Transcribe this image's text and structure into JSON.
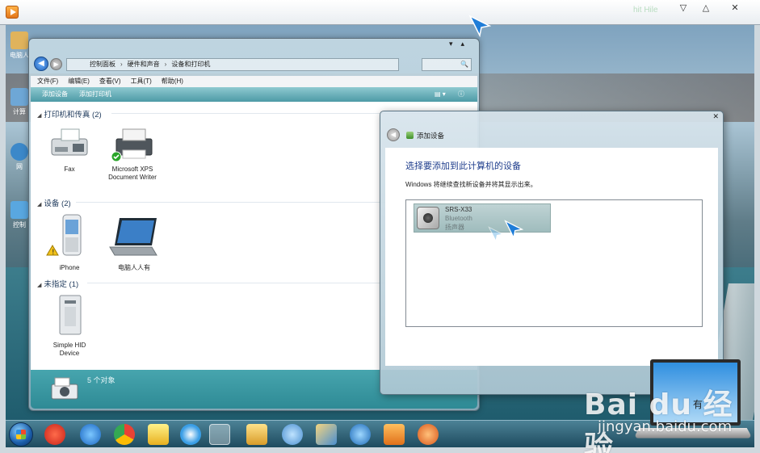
{
  "player": {
    "controls": [
      "▽",
      "△",
      "✕"
    ],
    "watermark_text": "hit Hile"
  },
  "desktop": {
    "icons": [
      {
        "label": "电脑人",
        "color": "#e0b35c"
      },
      {
        "label": "计算",
        "color": "#6ea7d6"
      },
      {
        "label": "网",
        "color": "#3c88c9"
      },
      {
        "label": "控制",
        "color": "#59a7e0"
      }
    ]
  },
  "explorer": {
    "breadcrumb": [
      "控制面板",
      "硬件和声音",
      "设备和打印机"
    ],
    "search_placeholder": "🔍",
    "menu": [
      "文件(F)",
      "编辑(E)",
      "查看(V)",
      "工具(T)",
      "帮助(H)"
    ],
    "commands": [
      "添加设备",
      "添加打印机"
    ],
    "groups": {
      "printers": {
        "title": "打印机和传真",
        "count": "(2)"
      },
      "devices": {
        "title": "设备",
        "count": "(2)"
      },
      "unspecified": {
        "title": "未指定",
        "count": "(1)"
      }
    },
    "items": {
      "fax": "Fax",
      "xps_line1": "Microsoft XPS",
      "xps_line2": "Document Writer",
      "iphone": "iPhone",
      "pc": "电脑人人有",
      "hid_line1": "Simple HID",
      "hid_line2": "Device"
    },
    "status": "5 个对象"
  },
  "dialog": {
    "title": "添加设备",
    "heading": "选择要添加到此计算机的设备",
    "subtitle": "Windows 将继续查找新设备并将其显示出来。",
    "device": {
      "name": "SRS-X33",
      "type": "Bluetooth",
      "kind": "扬声器"
    }
  },
  "watermark": {
    "logo": "Bai du 经验",
    "url": "jingyan.baidu.com",
    "extra": "有"
  },
  "colors": {
    "accent": "#1e3d8c",
    "selection": "#a9c4c5",
    "taskbar": "#2a5b70"
  }
}
